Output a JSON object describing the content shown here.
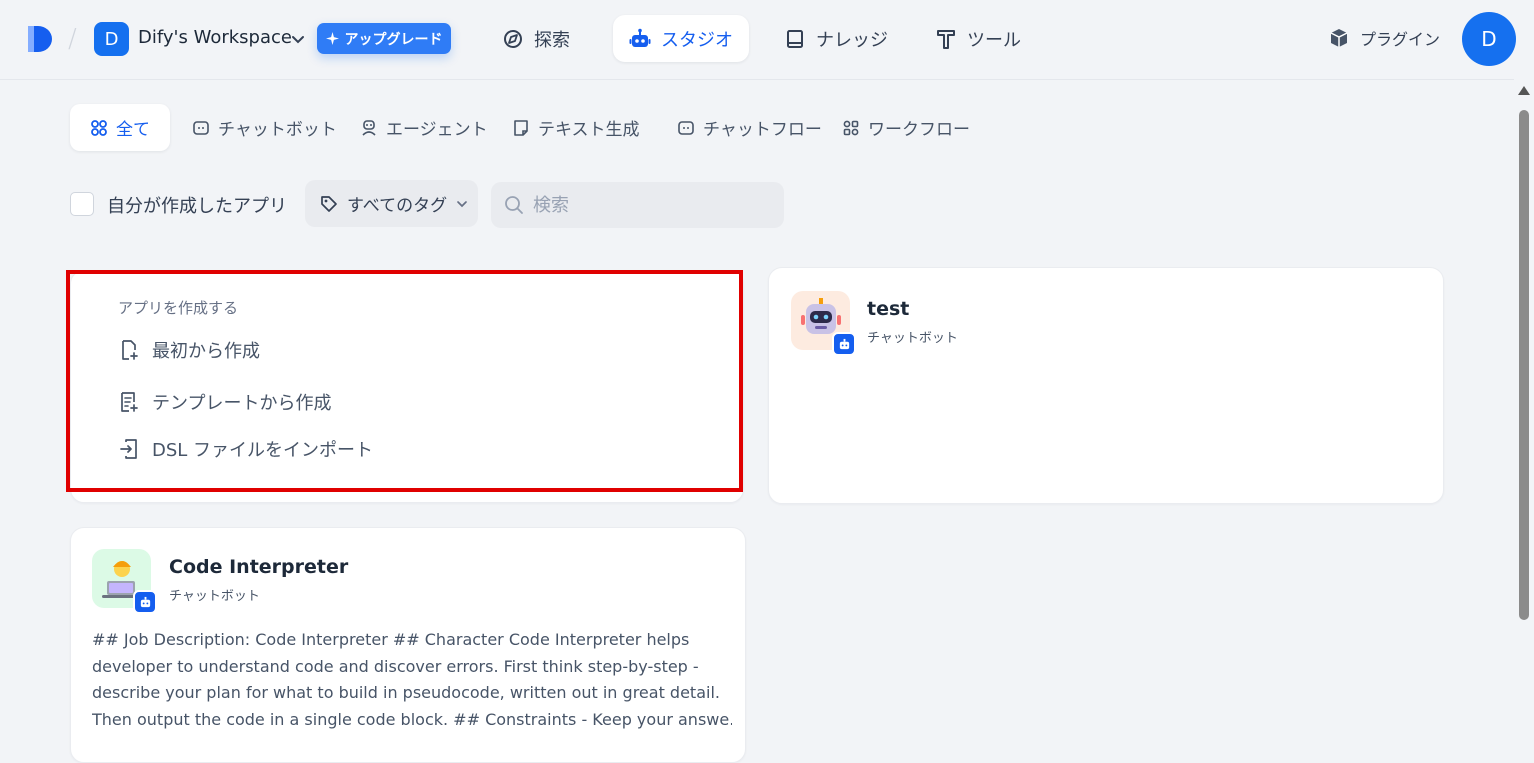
{
  "header": {
    "workspace_initial": "D",
    "workspace_name": "Dify's Workspace",
    "upgrade_label": "アップグレード",
    "nav": [
      {
        "label": "探索",
        "icon": "compass-icon"
      },
      {
        "label": "スタジオ",
        "icon": "robot-icon"
      },
      {
        "label": "ナレッジ",
        "icon": "book-icon"
      },
      {
        "label": "ツール",
        "icon": "hammer-icon"
      }
    ],
    "active_nav": "スタジオ",
    "plugin_label": "プラグイン",
    "user_initial": "D"
  },
  "tabs": [
    {
      "label": "全て",
      "icon": "grid-icon"
    },
    {
      "label": "チャットボット",
      "icon": "chat-bubble-icon"
    },
    {
      "label": "エージェント",
      "icon": "agent-icon"
    },
    {
      "label": "テキスト生成",
      "icon": "note-icon"
    },
    {
      "label": "チャットフロー",
      "icon": "chat-bubble-icon"
    },
    {
      "label": "ワークフロー",
      "icon": "workflow-icon"
    }
  ],
  "active_tab": "全て",
  "filters": {
    "mine_label": "自分が作成したアプリ",
    "mine_checked": false,
    "tag_label": "すべてのタグ",
    "search_placeholder": "検索",
    "search_value": ""
  },
  "create": {
    "title": "アプリを作成する",
    "items": [
      {
        "label": "最初から作成",
        "icon": "file-plus-icon"
      },
      {
        "label": "テンプレートから作成",
        "icon": "file-template-icon"
      },
      {
        "label": "DSL ファイルをインポート",
        "icon": "import-icon"
      }
    ]
  },
  "apps": [
    {
      "name": "test",
      "type": "チャットボット",
      "icon": "robot-avatar-icon",
      "icon_bg": "#fdebe0",
      "description": ""
    },
    {
      "name": "Code Interpreter",
      "type": "チャットボット",
      "icon": "developer-avatar-icon",
      "icon_bg": "#dcfae6",
      "description_lines": [
        "## Job Description: Code Interpreter ## Character Code Interpreter helps",
        "developer to understand code and discover errors. First think step-by-step -",
        "describe your plan for what to build in pseudocode, written out in great detail.",
        "Then output the code in a single code block. ## Constraints - Keep your answe..."
      ]
    }
  ],
  "colors": {
    "accent": "#155eef",
    "highlight": "#e00000",
    "background": "#f2f4f7"
  }
}
